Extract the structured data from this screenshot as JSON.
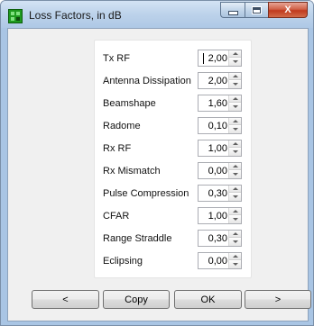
{
  "window": {
    "title": "Loss Factors, in dB",
    "icon": "app-grid-icon",
    "accent": "#1f9a1f"
  },
  "caption": {
    "minimize_icon": "minimize-icon",
    "maximize_icon": "maximize-icon",
    "close_label": "X"
  },
  "factors": [
    {
      "label": "Tx RF",
      "value": "2,00"
    },
    {
      "label": "Antenna Dissipation",
      "value": "2,00"
    },
    {
      "label": "Beamshape",
      "value": "1,60"
    },
    {
      "label": "Radome",
      "value": "0,10"
    },
    {
      "label": "Rx RF",
      "value": "1,00"
    },
    {
      "label": "Rx Mismatch",
      "value": "0,00"
    },
    {
      "label": "Pulse Compression",
      "value": "0,30"
    },
    {
      "label": "CFAR",
      "value": "1,00"
    },
    {
      "label": "Range Straddle",
      "value": "0,30"
    },
    {
      "label": "Eclipsing",
      "value": "0,00"
    }
  ],
  "buttons": {
    "prev": "<",
    "copy": "Copy",
    "ok": "OK",
    "next": ">"
  }
}
